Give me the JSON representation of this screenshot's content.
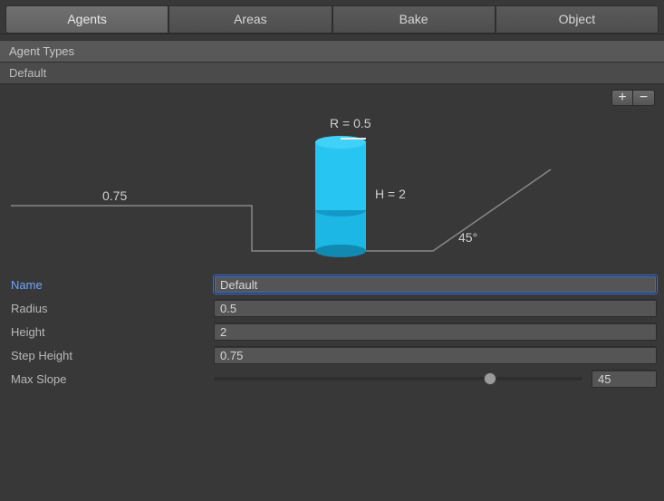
{
  "tabs": {
    "agents": "Agents",
    "areas": "Areas",
    "bake": "Bake",
    "object": "Object",
    "active": "agents"
  },
  "agent_types_header": "Agent Types",
  "agent_types": [
    {
      "name": "Default"
    }
  ],
  "diagram": {
    "radius_label": "R = 0.5",
    "height_label": "H = 2",
    "step_label": "0.75",
    "slope_label": "45°"
  },
  "fields": {
    "name": {
      "label": "Name",
      "value": "Default"
    },
    "radius": {
      "label": "Radius",
      "value": "0.5"
    },
    "height": {
      "label": "Height",
      "value": "2"
    },
    "step_height": {
      "label": "Step Height",
      "value": "0.75"
    },
    "max_slope": {
      "label": "Max Slope",
      "value": "45",
      "min": 0,
      "max": 60,
      "percent": 75
    }
  },
  "buttons": {
    "plus": "+",
    "minus": "−"
  }
}
